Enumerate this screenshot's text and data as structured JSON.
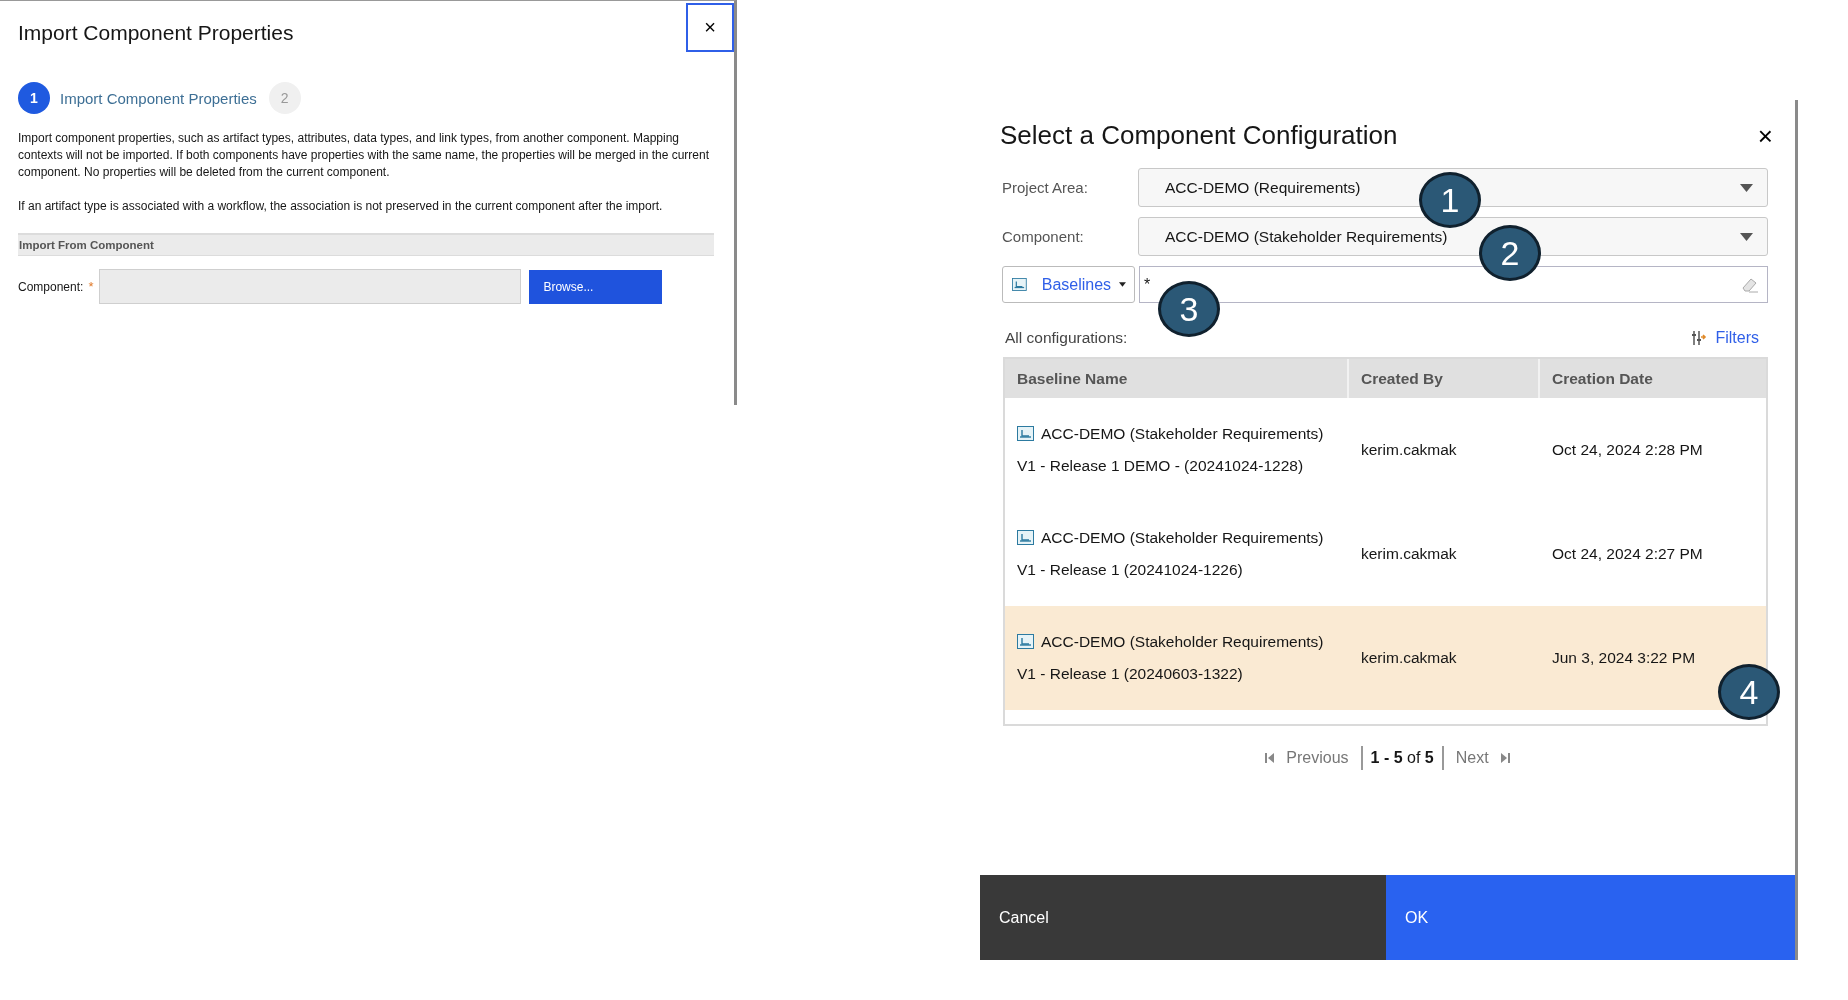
{
  "import_dialog": {
    "title": "Import Component Properties",
    "close": "×",
    "steps": [
      {
        "number": "1",
        "label": "Import Component Properties",
        "selected": true
      },
      {
        "number": "2",
        "selected": false
      }
    ],
    "paragraphs": [
      "Import component properties, such as artifact types, attributes, data types, and link types, from another component. Mapping contexts will not be imported. If both components have properties with the same name, the properties will be merged in the current component. No properties will be deleted from the current component.",
      "If an artifact type is associated with a workflow, the association is not preserved in the current component after the import."
    ],
    "section": "Import From Component",
    "component_field": {
      "label": "Component:",
      "required_mark": "*"
    },
    "browse_button": "Browse..."
  },
  "config_dialog": {
    "title": "Select a Component Configuration",
    "close": "×",
    "project_area": {
      "label": "Project Area:",
      "value": "ACC-DEMO (Requirements)"
    },
    "component": {
      "label": "Component:",
      "value": "ACC-DEMO (Stakeholder Requirements)"
    },
    "type_menu": "Baselines",
    "filter_value": "*",
    "list_label": "All configurations:",
    "filters_link": "Filters",
    "table": {
      "columns": [
        "Baseline Name",
        "Created By",
        "Creation Date"
      ],
      "rows": [
        {
          "name": "ACC-DEMO (Stakeholder Requirements) V1 - Release 1 DEMO - (20241024-1228)",
          "created_by": "kerim.cakmak",
          "date": "Oct 24, 2024 2:28 PM",
          "selected": false
        },
        {
          "name": "ACC-DEMO (Stakeholder Requirements) V1 - Release 1 (20241024-1226)",
          "created_by": "kerim.cakmak",
          "date": "Oct 24, 2024 2:27 PM",
          "selected": false
        },
        {
          "name": "ACC-DEMO (Stakeholder Requirements) V1 - Release 1 (20240603-1322)",
          "created_by": "kerim.cakmak",
          "date": "Jun 3, 2024 3:22 PM",
          "selected": true
        }
      ]
    },
    "pagination": {
      "previous": {
        "label": "Previous",
        "disabled": true
      },
      "range": "**1 - 5** of **5**",
      "next": {
        "label": "Next",
        "disabled": true
      }
    },
    "buttons": [
      {
        "label": "Cancel",
        "kind": "secondary"
      },
      {
        "label": "OK",
        "kind": "primary"
      }
    ],
    "callouts": [
      "1",
      "2",
      "3",
      "4"
    ]
  }
}
